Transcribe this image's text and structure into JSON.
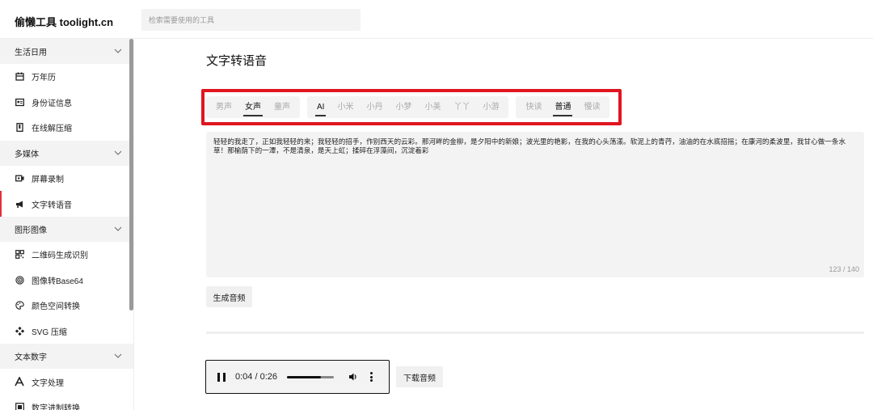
{
  "header": {
    "logo": "偷懒工具 toolight.cn",
    "search_placeholder": "检索需要使用的工具"
  },
  "sidebar": {
    "groups": [
      {
        "label": "生活日用",
        "items": [
          {
            "label": "万年历",
            "icon": "calendar-icon"
          },
          {
            "label": "身份证信息",
            "icon": "id-card-icon"
          },
          {
            "label": "在线解压缩",
            "icon": "archive-icon"
          }
        ]
      },
      {
        "label": "多媒体",
        "items": [
          {
            "label": "屏幕录制",
            "icon": "screen-record-icon"
          },
          {
            "label": "文字转语音",
            "icon": "megaphone-icon",
            "active": true
          }
        ]
      },
      {
        "label": "图形图像",
        "items": [
          {
            "label": "二维码生成识别",
            "icon": "qrcode-icon"
          },
          {
            "label": "图像转Base64",
            "icon": "target-icon"
          },
          {
            "label": "颜色空间转换",
            "icon": "palette-icon"
          },
          {
            "label": "SVG 压缩",
            "icon": "svg-icon"
          }
        ]
      },
      {
        "label": "文本数字",
        "items": [
          {
            "label": "文字处理",
            "icon": "font-icon"
          },
          {
            "label": "数字进制转换",
            "icon": "number-icon"
          }
        ]
      }
    ]
  },
  "main": {
    "title": "文字转语音",
    "voice_gender": {
      "options": [
        "男声",
        "女声",
        "童声"
      ],
      "selected": "女声"
    },
    "voice_model": {
      "options": [
        "AI",
        "小米",
        "小丹",
        "小梦",
        "小美",
        "丫丫",
        "小游"
      ],
      "selected": "AI"
    },
    "speed": {
      "options": [
        "快读",
        "普通",
        "慢读"
      ],
      "selected": "普通"
    },
    "text": "轻轻的我走了，正如我轻轻的来；我轻轻的招手，作别西天的云彩。那河畔的金柳，是夕阳中的新娘；波光里的艳影，在我的心头荡漾。软泥上的青荇，油油的在水底招摇；在康河的柔波里，我甘心做一条水草！那榆荫下的一潭，不是清泉，是天上虹；揉碎在浮藻间，沉淀着彩",
    "counter": "123 / 140",
    "generate_label": "生成音频",
    "download_label": "下载音频",
    "player": {
      "time": "0:04 / 0:26",
      "progress": 0.72
    }
  },
  "colors": {
    "accent": "#e01520",
    "active_bar": "#e0313a"
  }
}
